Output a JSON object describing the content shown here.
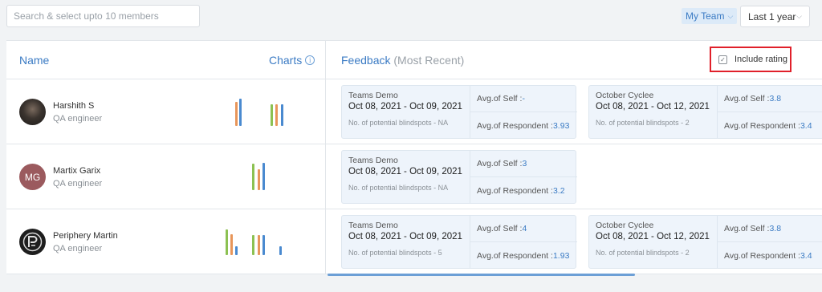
{
  "search": {
    "placeholder": "Search & select upto 10 members"
  },
  "filters": {
    "team": "My Team",
    "period": "Last 1 year"
  },
  "header": {
    "name": "Name",
    "charts": "Charts",
    "feedback": "Feedback",
    "feedback_sub": "(Most Recent)",
    "include_rating": "Include rating"
  },
  "members": [
    {
      "name": "Harshith S",
      "role": "QA engineer",
      "avatar_initials": "",
      "avatar_color": "#2b2b2b",
      "cards": [
        {
          "title": "Teams Demo",
          "date": "Oct 08, 2021 - Oct 09, 2021",
          "blindspots": "No. of potential blindspots - NA",
          "self_label": "Avg.of Self :",
          "self_value": "-",
          "resp_label": "Avg.of Respondent :",
          "resp_value": "3.93"
        },
        {
          "title": "October Cyclee",
          "date": "Oct 08, 2021 - Oct 12, 2021",
          "blindspots": "No. of potential blindspots - 2",
          "self_label": "Avg.of Self :",
          "self_value": "3.8",
          "resp_label": "Avg.of Respondent :",
          "resp_value": "3.4"
        }
      ]
    },
    {
      "name": "Martix Garix",
      "role": "QA engineer",
      "avatar_initials": "MG",
      "avatar_color": "#9b5a5e",
      "cards": [
        {
          "title": "Teams Demo",
          "date": "Oct 08, 2021 - Oct 09, 2021",
          "blindspots": "No. of potential blindspots - NA",
          "self_label": "Avg.of Self :",
          "self_value": "3",
          "resp_label": "Avg.of Respondent :",
          "resp_value": "3.2"
        }
      ]
    },
    {
      "name": "Periphery Martin",
      "role": "QA engineer",
      "avatar_initials": "",
      "avatar_color": "#1e1e1e",
      "cards": [
        {
          "title": "Teams Demo",
          "date": "Oct 08, 2021 - Oct 09, 2021",
          "blindspots": "No. of potential blindspots - 5",
          "self_label": "Avg.of Self :",
          "self_value": "4",
          "resp_label": "Avg.of Respondent :",
          "resp_value": "1.93"
        },
        {
          "title": "October Cyclee",
          "date": "Oct 08, 2021 - Oct 12, 2021",
          "blindspots": "No. of potential blindspots - 2",
          "self_label": "Avg.of Self :",
          "self_value": "3.8",
          "resp_label": "Avg.of Respondent :",
          "resp_value": "3.4"
        }
      ]
    }
  ],
  "colors": {
    "accent": "#3b7bc4",
    "bar_orange": "#e8965a",
    "bar_blue": "#4a8ad0",
    "bar_green": "#8cc152",
    "highlight": "#e0202a"
  }
}
